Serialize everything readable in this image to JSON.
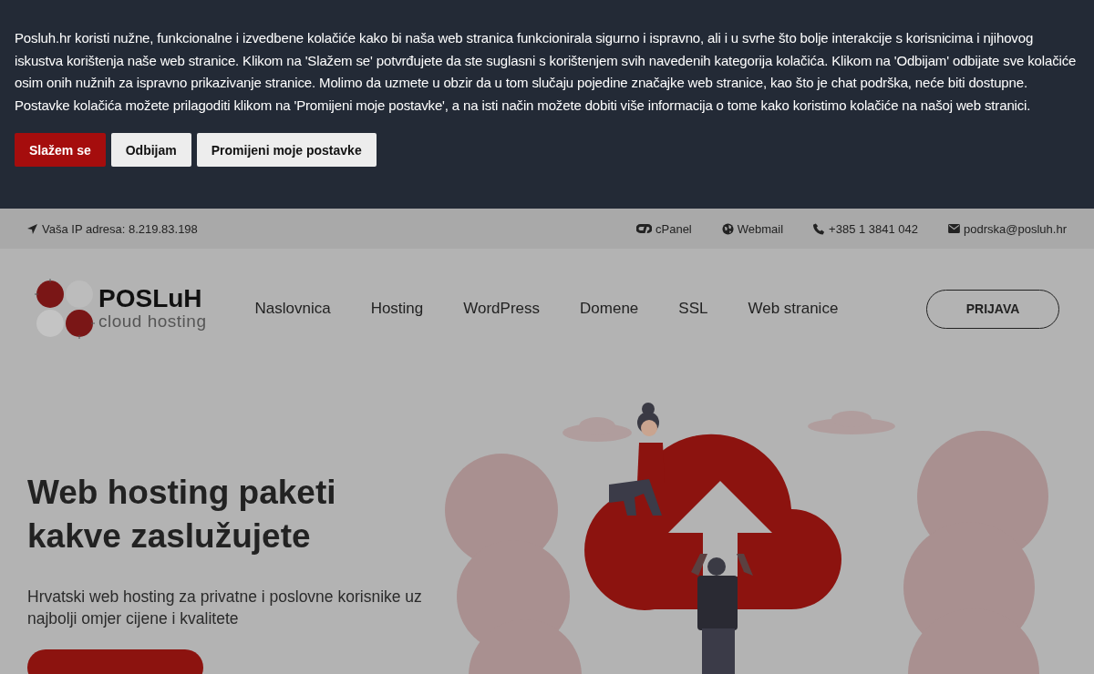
{
  "cookie_banner": {
    "text": "Posluh.hr koristi nužne, funkcionalne i izvedbene kolačiće kako bi naša web stranica funkcionirala sigurno i ispravno, ali i u svrhe što bolje interakcije s korisnicima i njihovog iskustva korištenja naše web stranice. Klikom na 'Slažem se' potvrđujete da ste suglasni s korištenjem svih navedenih kategorija kolačića. Klikom na 'Odbijam' odbijate sve kolačiće osim onih nužnih za ispravno prikazivanje stranice. Molimo da uzmete u obzir da u tom slučaju pojedine značajke web stranice, kao što je chat podrška, neće biti dostupne. Postavke kolačića možete prilagoditi klikom na 'Promijeni moje postavke', a na isti način možete dobiti više informacija o tome kako koristimo kolačiće na našoj web stranici.",
    "buttons": [
      {
        "label": "Slažem se",
        "kind": "primary"
      },
      {
        "label": "Odbijam",
        "kind": "secondary"
      },
      {
        "label": "Promijeni moje postavke",
        "kind": "secondary"
      }
    ]
  },
  "top_bar": {
    "ip": "Vaša IP adresa: 8.219.83.198",
    "links": [
      {
        "label": "cPanel",
        "kind": "cpanel"
      },
      {
        "label": "Webmail",
        "kind": "globe"
      },
      {
        "label": "+385 1 3841 042",
        "kind": "phone"
      },
      {
        "label": "podrska@posluh.hr",
        "kind": "mail"
      }
    ]
  },
  "header": {
    "logo": {
      "name": "POSLuH",
      "tagline": "cloud hosting"
    },
    "nav": [
      "Naslovnica",
      "Hosting",
      "WordPress",
      "Domene",
      "SSL",
      "Web stranice"
    ],
    "login": "PRIJAVA"
  },
  "hero": {
    "title": "Web hosting paketi kakve zaslužujete",
    "subtitle": "Hrvatski web hosting za privatne i poslovne korisnike uz najbolji omjer cijene i kvalitete"
  }
}
